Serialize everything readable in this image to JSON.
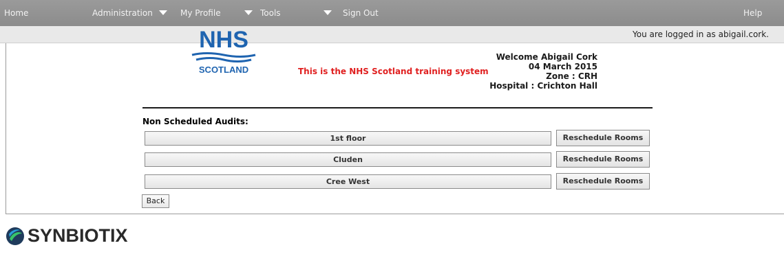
{
  "nav": {
    "home": "Home",
    "administration": "Administration",
    "my_profile": "My Profile",
    "tools": "Tools",
    "sign_out": "Sign Out",
    "help": "Help"
  },
  "login_status": "You are logged in as abigail.cork.",
  "logo": {
    "nhs": "NHS",
    "scotland": "SCOTLAND"
  },
  "training_notice": "This is the NHS Scotland training system",
  "welcome": {
    "greeting": "Welcome Abigail Cork",
    "date": "04 March 2015",
    "zone": "Zone : CRH",
    "hospital": "Hospital : Crichton Hall"
  },
  "audits": {
    "title": "Non Scheduled Audits:",
    "rows": [
      {
        "name": "1st floor",
        "action": "Reschedule Rooms"
      },
      {
        "name": "Cluden",
        "action": "Reschedule Rooms"
      },
      {
        "name": "Cree West",
        "action": "Reschedule Rooms"
      }
    ]
  },
  "back_label": "Back",
  "footer_brand": "SYNBIOTIX",
  "colors": {
    "nav_bg": "#9a9a9a",
    "nhs_blue": "#1f64b0",
    "notice_red": "#e02020"
  }
}
